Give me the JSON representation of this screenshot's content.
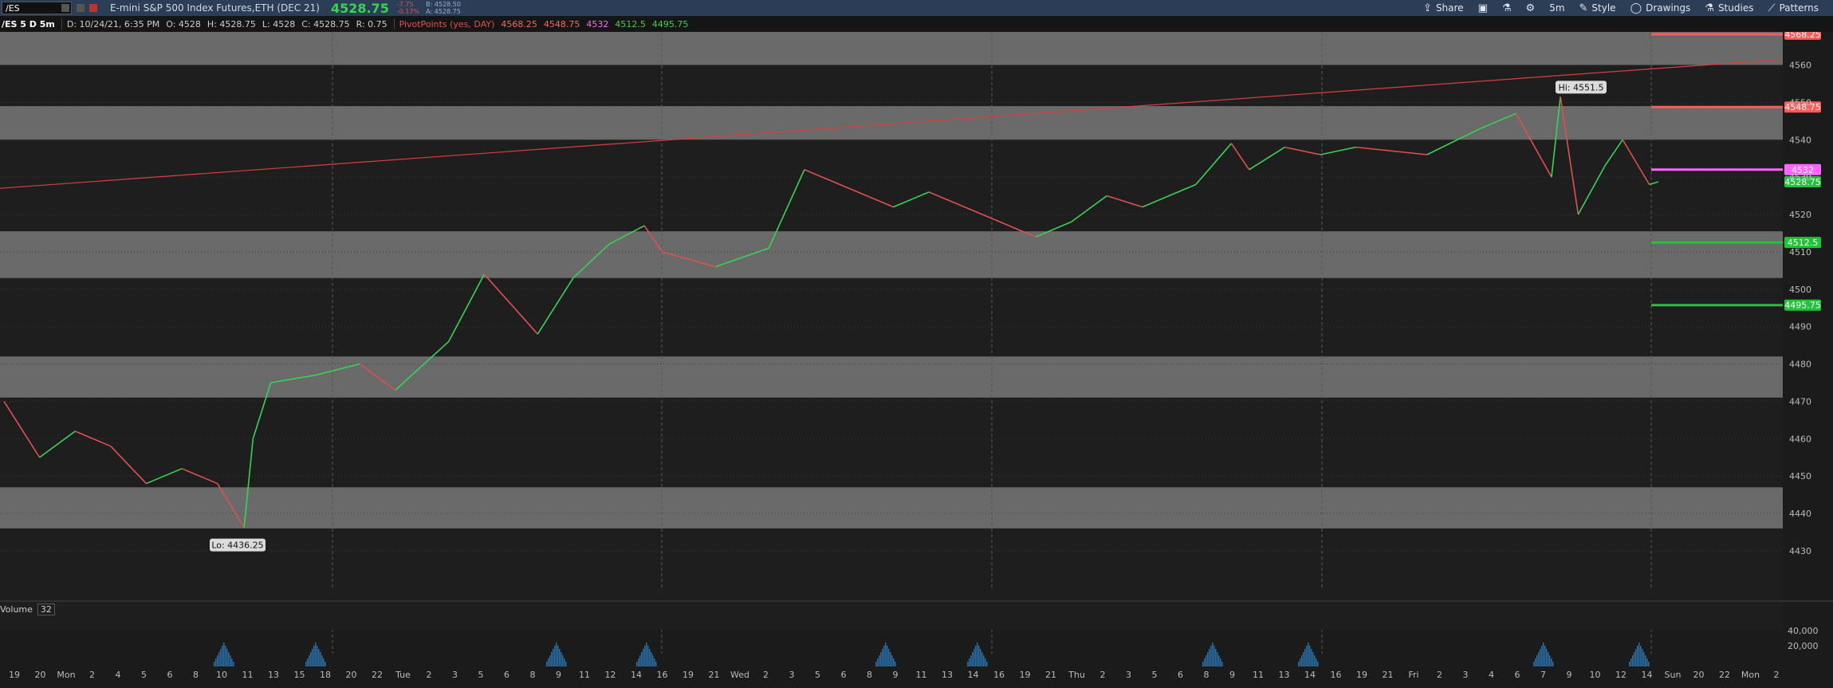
{
  "toolbar": {
    "symbol": "/ES",
    "title": "E-mini S&P 500 Index Futures,ETH (DEC 21)",
    "last_price": "4528.75",
    "change": "-7.75",
    "change_pct": "-0.17%",
    "bid": "B: 4528.50",
    "ask": "A: 4528.75",
    "share_label": "Share",
    "interval_label": "5m",
    "style_label": "Style",
    "drawings_label": "Drawings",
    "studies_label": "Studies",
    "patterns_label": "Patterns"
  },
  "info": {
    "chart_label": "/ES 5 D 5m",
    "date": "D: 10/24/21, 6:35 PM",
    "open": "O: 4528",
    "high": "H: 4528.75",
    "low": "L: 4528",
    "close": "C: 4528.75",
    "range": "R: 0.75",
    "study_name": "PivotPoints (yes, DAY)",
    "pp_values": [
      "4568.25",
      "4548.75",
      "4532",
      "4512.5",
      "4495.75"
    ]
  },
  "volume": {
    "label": "Volume",
    "period": "32"
  },
  "colors": {
    "up": "#39d353",
    "down": "#e05050",
    "pivot_r": "#ff5a5a",
    "pivot_p": "#ff66ff",
    "pivot_s": "#22c33a",
    "band": "#6a6a6a"
  },
  "chart_data": {
    "type": "line",
    "price_axis": [
      4560,
      4550,
      4540,
      4530,
      4520,
      4510,
      4500,
      4490,
      4480,
      4470,
      4460,
      4450,
      4440,
      4430
    ],
    "time_axis": [
      "19",
      "20",
      "Mon",
      "2",
      "4",
      "5",
      "6",
      "8",
      "10",
      "11",
      "13",
      "15",
      "18",
      "20",
      "22",
      "Tue",
      "2",
      "3",
      "5",
      "6",
      "8",
      "9",
      "11",
      "12",
      "14",
      "16",
      "19",
      "21",
      "Wed",
      "2",
      "3",
      "5",
      "6",
      "8",
      "9",
      "11",
      "13",
      "14",
      "16",
      "19",
      "21",
      "Thu",
      "2",
      "3",
      "5",
      "6",
      "8",
      "9",
      "11",
      "13",
      "14",
      "16",
      "19",
      "21",
      "Fri",
      "2",
      "3",
      "4",
      "6",
      "7",
      "9",
      "10",
      "12",
      "14",
      "Sun",
      "20",
      "22",
      "Mon",
      "2"
    ],
    "volume_axis": [
      "40,000",
      "20,000"
    ],
    "pivot_levels": [
      {
        "label": "4568.25",
        "value": 4568.25
      },
      {
        "label": "4548.75",
        "value": 4548.75
      },
      {
        "label": "4532",
        "value": 4532
      },
      {
        "label": "4512.5",
        "value": 4512.5
      },
      {
        "label": "4495.75",
        "value": 4495.75
      }
    ],
    "last_price_tag": "4528.75",
    "bands": [
      [
        4560,
        4570
      ],
      [
        4540,
        4549
      ],
      [
        4503,
        4515.5
      ],
      [
        4471,
        4482
      ],
      [
        4436,
        4447
      ]
    ],
    "hi_label": "Hi: 4551.5",
    "lo_label": "Lo: 4436.25",
    "trendline": {
      "from": 4527,
      "to": 4561.5
    },
    "series": [
      {
        "x": [
          0,
          0.02,
          0.04,
          0.06,
          0.08,
          0.1,
          0.12,
          0.135,
          0.14,
          0.15,
          0.175,
          0.2,
          0.22,
          0.25,
          0.27,
          0.3,
          0.32,
          0.34,
          0.36,
          0.37,
          0.4,
          0.43,
          0.45,
          0.48,
          0.5,
          0.52,
          0.55,
          0.58,
          0.6,
          0.62,
          0.64,
          0.67,
          0.69,
          0.7,
          0.72,
          0.74,
          0.76,
          0.8,
          0.83,
          0.85,
          0.87,
          0.875,
          0.885,
          0.9,
          0.91,
          0.925,
          0.93
        ],
        "values": [
          4470,
          4455,
          4462,
          4458,
          4448,
          4452,
          4448,
          4436.25,
          4460,
          4475,
          4477,
          4480,
          4473,
          4486,
          4504,
          4488,
          4503,
          4512,
          4517,
          4510,
          4506,
          4511,
          4532,
          4526,
          4522,
          4526,
          4520,
          4514,
          4518,
          4525,
          4522,
          4528,
          4539,
          4532,
          4538,
          4536,
          4538,
          4536,
          4543,
          4547,
          4530,
          4551.5,
          4520,
          4533,
          4540,
          4528,
          4528.75
        ]
      }
    ]
  }
}
